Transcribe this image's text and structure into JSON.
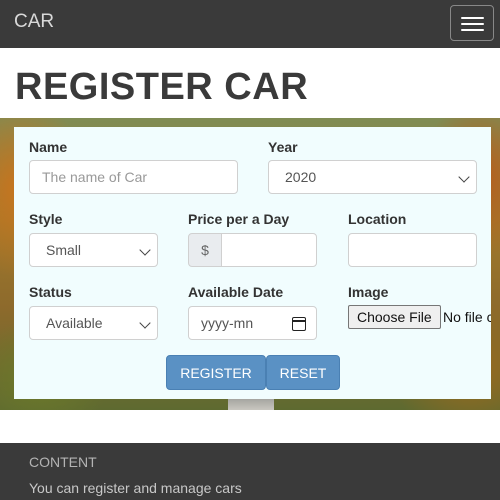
{
  "navbar": {
    "brand": "CAR",
    "menu_icon": "hamburger-icon"
  },
  "page": {
    "title": "REGISTER CAR"
  },
  "form": {
    "name": {
      "label": "Name",
      "placeholder": "The name of Car"
    },
    "year": {
      "label": "Year",
      "value": "2020"
    },
    "style": {
      "label": "Style",
      "value": "Small"
    },
    "price": {
      "label": "Price per a Day",
      "addon": "$"
    },
    "location": {
      "label": "Location"
    },
    "status": {
      "label": "Status",
      "value": "Available"
    },
    "available_date": {
      "label": "Available Date",
      "placeholder": "yyyy-mn"
    },
    "image": {
      "label": "Image",
      "button": "Choose File",
      "text": "No file chosen"
    },
    "register_label": "REGISTER",
    "reset_label": "RESET"
  },
  "footer": {
    "title": "CONTENT",
    "text": "You can register and manage cars"
  },
  "colors": {
    "navbar": "#3a3a3a",
    "panel": "#f1fdfe",
    "button": "#5a91c4"
  }
}
